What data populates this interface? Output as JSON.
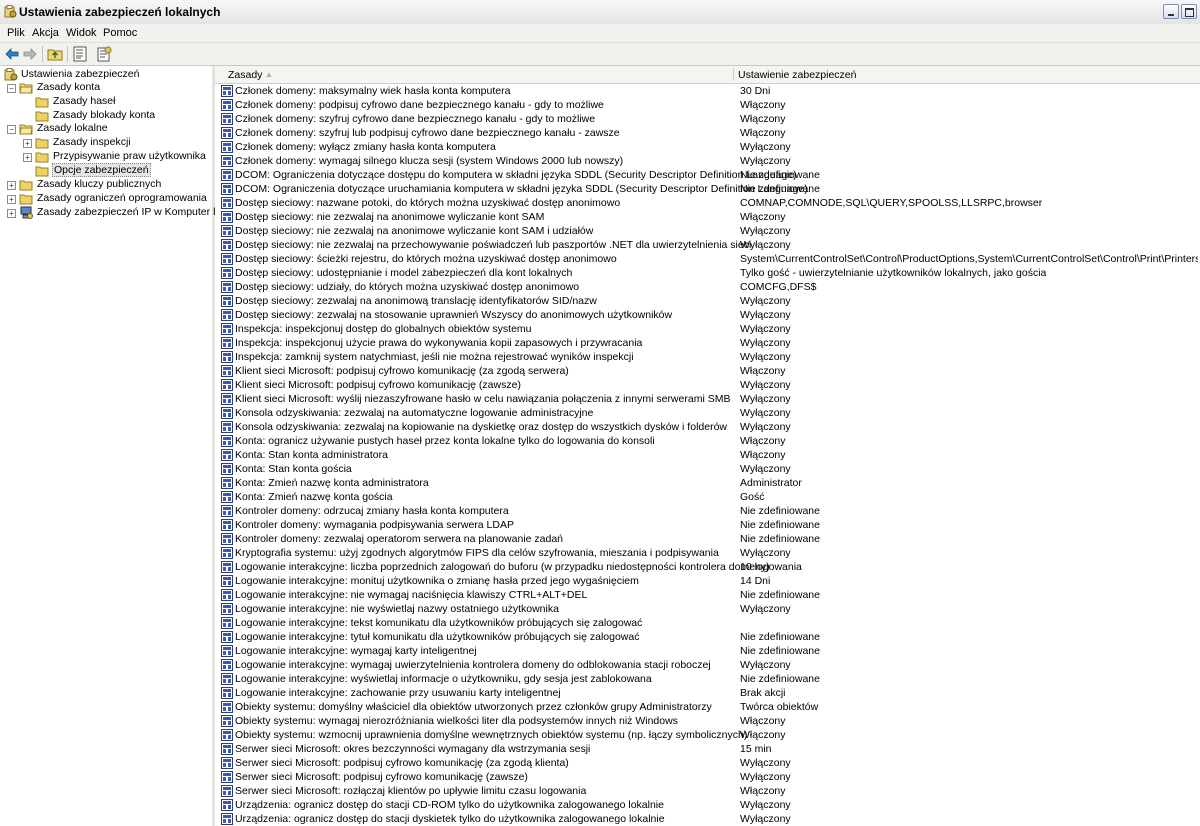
{
  "window": {
    "title": "Ustawienia zabezpieczeń lokalnych"
  },
  "menu": [
    "Plik",
    "Akcja",
    "Widok",
    "Pomoc"
  ],
  "toolbar": {
    "icons": [
      "back-arrow-icon",
      "forward-arrow-icon",
      "up-folder-icon",
      "show-hide-tree-icon",
      "properties-icon"
    ]
  },
  "tree": [
    {
      "label": "Ustawienia zabezpieczeń",
      "level": 0,
      "expander": "",
      "icon": "security-settings-icon"
    },
    {
      "label": "Zasady konta",
      "level": 1,
      "expander": "−",
      "icon": "folder-open-icon"
    },
    {
      "label": "Zasady haseł",
      "level": 2,
      "expander": "",
      "icon": "folder-icon"
    },
    {
      "label": "Zasady blokady konta",
      "level": 2,
      "expander": "",
      "icon": "folder-icon"
    },
    {
      "label": "Zasady lokalne",
      "level": 1,
      "expander": "−",
      "icon": "folder-open-icon"
    },
    {
      "label": "Zasady inspekcji",
      "level": 2,
      "expander": "+",
      "icon": "folder-icon"
    },
    {
      "label": "Przypisywanie praw użytkownika",
      "level": 2,
      "expander": "+",
      "icon": "folder-icon"
    },
    {
      "label": "Opcje zabezpieczeń",
      "level": 2,
      "expander": "",
      "icon": "folder-icon",
      "selected": true
    },
    {
      "label": "Zasady kluczy publicznych",
      "level": 1,
      "expander": "+",
      "icon": "folder-icon"
    },
    {
      "label": "Zasady ograniczeń oprogramowania",
      "level": 1,
      "expander": "+",
      "icon": "folder-icon"
    },
    {
      "label": "Zasady zabezpieczeń IP w Komputer lokalny",
      "level": 1,
      "expander": "+",
      "icon": "ip-security-icon"
    }
  ],
  "list": {
    "columns": [
      "Zasady",
      "Ustawienie zabezpieczeń"
    ],
    "rows": [
      [
        "Członek domeny: maksymalny wiek hasła konta komputera",
        "30 Dni"
      ],
      [
        "Członek domeny: podpisuj cyfrowo dane bezpiecznego kanału - gdy to możliwe",
        "Włączony"
      ],
      [
        "Członek domeny: szyfruj cyfrowo dane bezpiecznego kanału - gdy to możliwe",
        "Włączony"
      ],
      [
        "Członek domeny: szyfruj lub podpisuj cyfrowo dane bezpiecznego kanału - zawsze",
        "Włączony"
      ],
      [
        "Członek domeny: wyłącz zmiany hasła konta komputera",
        "Wyłączony"
      ],
      [
        "Członek domeny: wymagaj silnego klucza sesji (system Windows 2000 lub nowszy)",
        "Wyłączony"
      ],
      [
        "DCOM: Ograniczenia dotyczące dostępu do komputera w składni języka SDDL (Security Descriptor Definition Language)",
        "Nie zdefiniowane"
      ],
      [
        "DCOM: Ograniczenia dotyczące uruchamiania komputera w składni języka SDDL (Security Descriptor Definition Language)",
        "Nie zdefiniowane"
      ],
      [
        "Dostęp sieciowy: nazwane potoki, do których można uzyskiwać dostęp anonimowo",
        "COMNAP,COMNODE,SQL\\QUERY,SPOOLSS,LLSRPC,browser"
      ],
      [
        "Dostęp sieciowy: nie zezwalaj na anonimowe wyliczanie kont SAM",
        "Włączony"
      ],
      [
        "Dostęp sieciowy: nie zezwalaj na anonimowe wyliczanie kont SAM i udziałów",
        "Wyłączony"
      ],
      [
        "Dostęp sieciowy: nie zezwalaj na przechowywanie poświadczeń lub paszportów .NET dla uwierzytelnienia sieci",
        "Wyłączony"
      ],
      [
        "Dostęp sieciowy: ścieżki rejestru, do których można uzyskiwać dostęp anonimowo",
        "System\\CurrentControlSet\\Control\\ProductOptions,System\\CurrentControlSet\\Control\\Print\\Printers,System\\Curr..."
      ],
      [
        "Dostęp sieciowy: udostępnianie i model zabezpieczeń dla kont lokalnych",
        "Tylko gość - uwierzytelnianie użytkowników lokalnych, jako gościa"
      ],
      [
        "Dostęp sieciowy: udziały, do których można uzyskiwać dostęp anonimowo",
        "COMCFG,DFS$"
      ],
      [
        "Dostęp sieciowy: zezwalaj na anonimową translację identyfikatorów SID/nazw",
        "Wyłączony"
      ],
      [
        "Dostęp sieciowy: zezwalaj na stosowanie uprawnień Wszyscy do anonimowych użytkowników",
        "Wyłączony"
      ],
      [
        "Inspekcja: inspekcjonuj dostęp do globalnych obiektów systemu",
        "Wyłączony"
      ],
      [
        "Inspekcja: inspekcjonuj użycie prawa do wykonywania kopii zapasowych i przywracania",
        "Wyłączony"
      ],
      [
        "Inspekcja: zamknij system natychmiast, jeśli nie można rejestrować wyników inspekcji",
        "Wyłączony"
      ],
      [
        "Klient sieci Microsoft: podpisuj cyfrowo komunikację (za zgodą serwera)",
        "Włączony"
      ],
      [
        "Klient sieci Microsoft: podpisuj cyfrowo komunikację (zawsze)",
        "Wyłączony"
      ],
      [
        "Klient sieci Microsoft: wyślij niezaszyfrowane hasło w celu nawiązania połączenia z innymi serwerami SMB",
        "Wyłączony"
      ],
      [
        "Konsola odzyskiwania: zezwalaj na automatyczne logowanie administracyjne",
        "Wyłączony"
      ],
      [
        "Konsola odzyskiwania: zezwalaj na kopiowanie na dyskietkę oraz dostęp do wszystkich dysków i folderów",
        "Wyłączony"
      ],
      [
        "Konta: ogranicz używanie pustych haseł przez konta lokalne tylko do logowania do konsoli",
        "Włączony"
      ],
      [
        "Konta: Stan konta administratora",
        "Włączony"
      ],
      [
        "Konta: Stan konta gościa",
        "Wyłączony"
      ],
      [
        "Konta: Zmień nazwę konta administratora",
        "Administrator"
      ],
      [
        "Konta: Zmień nazwę konta gościa",
        "Gość"
      ],
      [
        "Kontroler domeny: odrzucaj zmiany hasła konta komputera",
        "Nie zdefiniowane"
      ],
      [
        "Kontroler domeny: wymagania podpisywania serwera LDAP",
        "Nie zdefiniowane"
      ],
      [
        "Kontroler domeny: zezwalaj operatorom serwera na planowanie zadań",
        "Nie zdefiniowane"
      ],
      [
        "Kryptografia systemu: użyj zgodnych algorytmów FIPS dla celów szyfrowania, mieszania i podpisywania",
        "Wyłączony"
      ],
      [
        "Logowanie interakcyjne: liczba poprzednich zalogowań do buforu (w przypadku niedostępności kontrolera domeny)",
        "10 logowania"
      ],
      [
        "Logowanie interakcyjne: monituj użytkownika o zmianę hasła przed jego wygaśnięciem",
        "14 Dni"
      ],
      [
        "Logowanie interakcyjne: nie wymagaj naciśnięcia klawiszy CTRL+ALT+DEL",
        "Nie zdefiniowane"
      ],
      [
        "Logowanie interakcyjne: nie wyświetlaj nazwy ostatniego użytkownika",
        "Wyłączony"
      ],
      [
        "Logowanie interakcyjne: tekst komunikatu dla użytkowników próbujących się zalogować",
        ""
      ],
      [
        "Logowanie interakcyjne: tytuł komunikatu dla użytkowników próbujących się zalogować",
        "Nie zdefiniowane"
      ],
      [
        "Logowanie interakcyjne: wymagaj karty inteligentnej",
        "Nie zdefiniowane"
      ],
      [
        "Logowanie interakcyjne: wymagaj uwierzytelnienia kontrolera domeny do odblokowania stacji roboczej",
        "Wyłączony"
      ],
      [
        "Logowanie interakcyjne: wyświetlaj informacje o użytkowniku, gdy sesja jest zablokowana",
        "Nie zdefiniowane"
      ],
      [
        "Logowanie interakcyjne: zachowanie przy usuwaniu karty inteligentnej",
        "Brak akcji"
      ],
      [
        "Obiekty systemu: domyślny właściciel dla obiektów utworzonych przez członków grupy Administratorzy",
        "Twórca obiektów"
      ],
      [
        "Obiekty systemu: wymagaj nierozróżniania wielkości liter dla podsystemów innych niż Windows",
        "Włączony"
      ],
      [
        "Obiekty systemu: wzmocnij uprawnienia domyślne wewnętrznych obiektów systemu (np. łączy symbolicznych)",
        "Włączony"
      ],
      [
        "Serwer sieci Microsoft: okres bezczynności wymagany dla wstrzymania sesji",
        "15 min"
      ],
      [
        "Serwer sieci Microsoft: podpisuj cyfrowo komunikację (za zgodą klienta)",
        "Wyłączony"
      ],
      [
        "Serwer sieci Microsoft: podpisuj cyfrowo komunikację (zawsze)",
        "Wyłączony"
      ],
      [
        "Serwer sieci Microsoft: rozłączaj klientów po upływie limitu czasu logowania",
        "Włączony"
      ],
      [
        "Urządzenia: ogranicz dostęp do stacji CD-ROM tylko do użytkownika zalogowanego lokalnie",
        "Wyłączony"
      ],
      [
        "Urządzenia: ogranicz dostęp do stacji dyskietek tylko do użytkownika zalogowanego lokalnie",
        "Wyłączony"
      ]
    ]
  }
}
